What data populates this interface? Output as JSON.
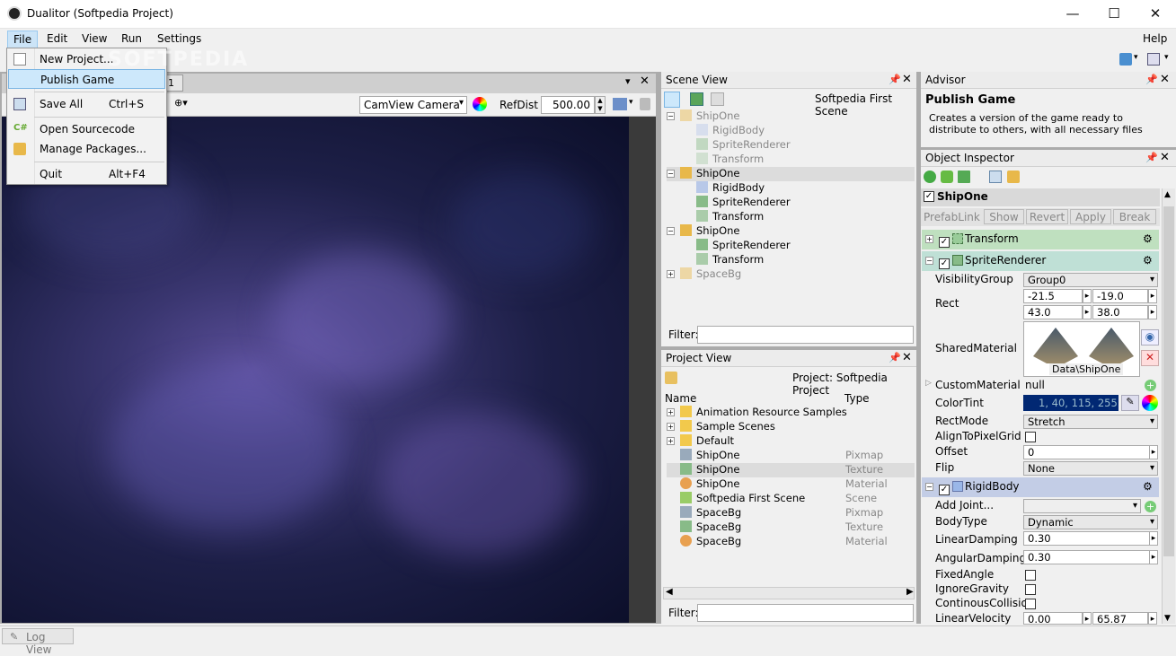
{
  "window": {
    "title": "Dualitor (Softpedia Project)",
    "minimize": "—",
    "maximize": "☐",
    "close": "✕"
  },
  "menubar": {
    "items": [
      "File",
      "Edit",
      "View",
      "Run",
      "Settings"
    ],
    "help": "Help"
  },
  "file_menu": {
    "new_project": "New Project...",
    "publish_game": "Publish Game",
    "save_all": "Save All",
    "save_all_shortcut": "Ctrl+S",
    "open_sourcecode": "Open Sourcecode",
    "manage_packages": "Manage Packages...",
    "quit": "Quit",
    "quit_shortcut": "Alt+F4"
  },
  "camview": {
    "tab_suffix": "1",
    "camera": "CamView Camera",
    "refdist_label": "RefDist",
    "refdist_value": "500.00"
  },
  "scene_view": {
    "title": "Scene View",
    "scene_name": "Softpedia First Scene",
    "items": [
      {
        "label": "ShipOne",
        "indent": 0,
        "expander": "−",
        "dim": true,
        "kind": "obj"
      },
      {
        "label": "RigidBody",
        "indent": 1,
        "dim": true,
        "kind": "comp"
      },
      {
        "label": "SpriteRenderer",
        "indent": 1,
        "dim": true,
        "kind": "sprite"
      },
      {
        "label": "Transform",
        "indent": 1,
        "dim": true,
        "kind": "xf"
      },
      {
        "label": "ShipOne",
        "indent": 0,
        "expander": "−",
        "dim": false,
        "kind": "obj",
        "selected": true
      },
      {
        "label": "RigidBody",
        "indent": 1,
        "dim": false,
        "kind": "comp"
      },
      {
        "label": "SpriteRenderer",
        "indent": 1,
        "dim": false,
        "kind": "sprite"
      },
      {
        "label": "Transform",
        "indent": 1,
        "dim": false,
        "kind": "xf"
      },
      {
        "label": "ShipOne",
        "indent": 0,
        "expander": "−",
        "dim": false,
        "kind": "obj"
      },
      {
        "label": "SpriteRenderer",
        "indent": 1,
        "dim": false,
        "kind": "sprite"
      },
      {
        "label": "Transform",
        "indent": 1,
        "dim": false,
        "kind": "xf"
      },
      {
        "label": "SpaceBg",
        "indent": 0,
        "expander": "+",
        "dim": true,
        "kind": "obj"
      }
    ],
    "filter_label": "Filter:"
  },
  "project_view": {
    "title": "Project View",
    "project_label": "Project: Softpedia Project",
    "col_name": "Name",
    "col_type": "Type",
    "items": [
      {
        "label": "Animation Resource Samples",
        "type": "",
        "kind": "folder",
        "expander": "+"
      },
      {
        "label": "Sample Scenes",
        "type": "",
        "kind": "folder",
        "expander": "+"
      },
      {
        "label": "Default",
        "type": "",
        "kind": "folder",
        "expander": "+"
      },
      {
        "label": "ShipOne",
        "type": "Pixmap",
        "kind": "pixmap"
      },
      {
        "label": "ShipOne",
        "type": "Texture",
        "kind": "texture",
        "selected": true
      },
      {
        "label": "ShipOne",
        "type": "Material",
        "kind": "material"
      },
      {
        "label": "Softpedia First Scene",
        "type": "Scene",
        "kind": "scene"
      },
      {
        "label": "SpaceBg",
        "type": "Pixmap",
        "kind": "pixmap"
      },
      {
        "label": "SpaceBg",
        "type": "Texture",
        "kind": "texture"
      },
      {
        "label": "SpaceBg",
        "type": "Material",
        "kind": "material"
      }
    ],
    "filter_label": "Filter:"
  },
  "advisor": {
    "title": "Advisor",
    "heading": "Publish Game",
    "text": "Creates a version of the game ready to distribute to others, with all necessary files"
  },
  "inspector": {
    "title": "Object Inspector",
    "object": "ShipOne",
    "buttons": [
      "PrefabLink",
      "Show",
      "Revert",
      "Apply",
      "Break"
    ],
    "transform": "Transform",
    "sprite_renderer": "SpriteRenderer",
    "rigidbody": "RigidBody",
    "props": {
      "visibility_group": {
        "label": "VisibilityGroup",
        "value": "Group0"
      },
      "rect": {
        "label": "Rect",
        "x": "-21.5",
        "y": "-19.0",
        "w": "43.0",
        "h": "38.0"
      },
      "shared_material": {
        "label": "SharedMaterial",
        "value": "Data\\ShipOne"
      },
      "custom_material": {
        "label": "CustomMaterial",
        "value": "null"
      },
      "color_tint": {
        "label": "ColorTint",
        "value": "1, 40, 115, 255"
      },
      "rect_mode": {
        "label": "RectMode",
        "value": "Stretch"
      },
      "align": {
        "label": "AlignToPixelGrid"
      },
      "offset": {
        "label": "Offset",
        "value": "0"
      },
      "flip": {
        "label": "Flip",
        "value": "None"
      },
      "add_joint": {
        "label": "Add Joint..."
      },
      "body_type": {
        "label": "BodyType",
        "value": "Dynamic"
      },
      "linear_damping": {
        "label": "LinearDamping",
        "value": "0.30"
      },
      "angular_damping": {
        "label": "AngularDamping",
        "value": "0.30"
      },
      "fixed_angle": {
        "label": "FixedAngle"
      },
      "ignore_gravity": {
        "label": "IgnoreGravity"
      },
      "continuous": {
        "label": "ContinousCollision"
      },
      "linear_velocity": {
        "label": "LinearVelocity",
        "x": "0.00",
        "y": "65.87"
      }
    }
  },
  "status": {
    "log_view": "Log View"
  },
  "watermark": "SOFTPEDIA"
}
